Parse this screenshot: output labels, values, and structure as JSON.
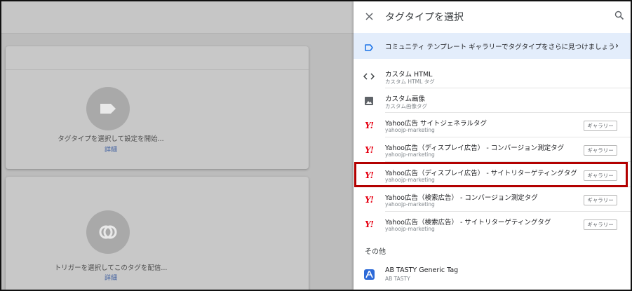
{
  "workspace": {
    "tag_card": {
      "hint": "タグタイプを選択して設定を開始...",
      "more": "詳細"
    },
    "trigger_card": {
      "hint": "トリガーを選択してこのタグを配信...",
      "more": "詳細"
    }
  },
  "panel": {
    "title": "タグタイプを選択",
    "community": {
      "text": "コミュニティ テンプレート ギャラリーでタグタイプをさらに見つけましょう"
    },
    "tag_types": [
      {
        "name": "カスタム HTML",
        "sub": "カスタム HTML タグ",
        "icon": "code-icon"
      },
      {
        "name": "カスタム画像",
        "sub": "カスタム画像タグ",
        "icon": "image-icon"
      },
      {
        "name": "Yahoo広告 サイトジェネラルタグ",
        "sub": "yahoojp-marketing",
        "icon": "yahoo-icon",
        "badge": "ギャラリー"
      },
      {
        "name": "Yahoo広告（ディスプレイ広告） - コンバージョン測定タグ",
        "sub": "yahoojp-marketing",
        "icon": "yahoo-icon",
        "badge": "ギャラリー"
      },
      {
        "name": "Yahoo広告（ディスプレイ広告） - サイトリターゲティングタグ",
        "sub": "yahoojp-marketing",
        "icon": "yahoo-icon",
        "badge": "ギャラリー"
      },
      {
        "name": "Yahoo広告（検索広告） - コンバージョン測定タグ",
        "sub": "yahoojp-marketing",
        "icon": "yahoo-icon",
        "badge": "ギャラリー"
      },
      {
        "name": "Yahoo広告（検索広告） - サイトリターゲティングタグ",
        "sub": "yahoojp-marketing",
        "icon": "yahoo-icon",
        "badge": "ギャラリー"
      }
    ],
    "other_section": "その他",
    "other_tags": [
      {
        "name": "AB TASTY Generic Tag",
        "sub": "AB TASTY",
        "icon": "ab-tasty-icon"
      }
    ],
    "yahoo_mark": "Y!"
  },
  "colors": {
    "highlight": "#b30000",
    "accent": "#1a73e8",
    "yahoo": "#e60012"
  }
}
